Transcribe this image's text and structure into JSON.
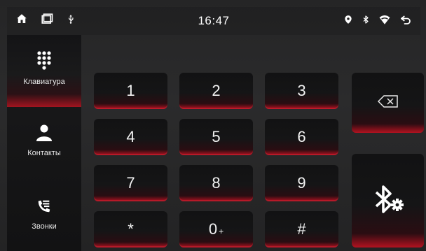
{
  "statusbar": {
    "time": "16:47",
    "icons_left": [
      "home-icon",
      "window-icon",
      "usb-icon"
    ],
    "icons_right": [
      "location-icon",
      "bluetooth-icon",
      "wifi-icon",
      "back-icon"
    ]
  },
  "nav": {
    "items": [
      {
        "label": "Клавиатура",
        "icon": "dialpad-icon",
        "active": true
      },
      {
        "label": "Контакты",
        "icon": "contact-icon",
        "active": false
      },
      {
        "label": "Звонки",
        "icon": "call-log-icon",
        "active": false
      }
    ]
  },
  "keypad": {
    "keys": [
      {
        "label": "1",
        "sub": ""
      },
      {
        "label": "2",
        "sub": ""
      },
      {
        "label": "3",
        "sub": ""
      },
      {
        "label": "4",
        "sub": ""
      },
      {
        "label": "5",
        "sub": ""
      },
      {
        "label": "6",
        "sub": ""
      },
      {
        "label": "7",
        "sub": ""
      },
      {
        "label": "8",
        "sub": ""
      },
      {
        "label": "9",
        "sub": ""
      },
      {
        "label": "*",
        "sub": ""
      },
      {
        "label": "0",
        "sub": "+"
      },
      {
        "label": "#",
        "sub": ""
      }
    ]
  },
  "actions": {
    "backspace_icon": "backspace-icon",
    "bluetooth_settings_icon": "bluetooth-settings-icon"
  },
  "colors": {
    "accent_red": "#b31220",
    "background": "#2b2b2c",
    "text": "#ffffff"
  }
}
